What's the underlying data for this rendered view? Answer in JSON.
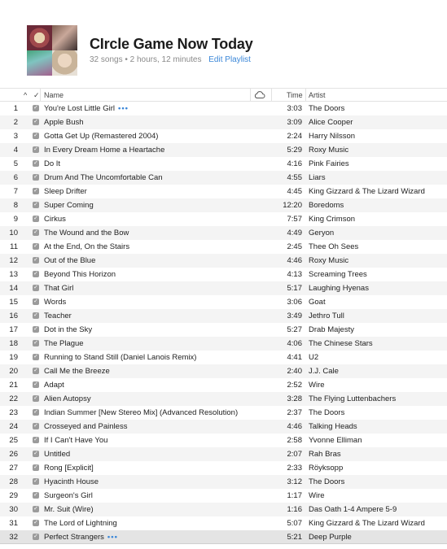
{
  "playlist": {
    "title": "CIrcle Game Now Today",
    "meta": "32 songs • 2 hours, 12 minutes",
    "edit_label": "Edit Playlist"
  },
  "columns": {
    "sort": "^",
    "check": "✓",
    "name": "Name",
    "cloud_icon": "cloud-icon",
    "time": "Time",
    "artist": "Artist"
  },
  "rows": [
    {
      "num": "1",
      "name": "You're Lost Little Girl",
      "dots": true,
      "time": "3:03",
      "artist": "The Doors"
    },
    {
      "num": "2",
      "name": "Apple Bush",
      "time": "3:09",
      "artist": "Alice Cooper"
    },
    {
      "num": "3",
      "name": "Gotta Get Up (Remastered 2004)",
      "time": "2:24",
      "artist": "Harry Nilsson"
    },
    {
      "num": "4",
      "name": "In Every Dream Home a Heartache",
      "time": "5:29",
      "artist": "Roxy Music"
    },
    {
      "num": "5",
      "name": "Do It",
      "time": "4:16",
      "artist": "Pink Fairies"
    },
    {
      "num": "6",
      "name": "Drum And The Uncomfortable Can",
      "time": "4:55",
      "artist": "Liars"
    },
    {
      "num": "7",
      "name": "Sleep Drifter",
      "time": "4:45",
      "artist": "King Gizzard & The Lizard Wizard"
    },
    {
      "num": "8",
      "name": "Super Coming",
      "time": "12:20",
      "artist": "Boredoms"
    },
    {
      "num": "9",
      "name": "Cirkus",
      "time": "7:57",
      "artist": "King Crimson"
    },
    {
      "num": "10",
      "name": "The Wound and the Bow",
      "time": "4:49",
      "artist": "Geryon"
    },
    {
      "num": "11",
      "name": "At the End, On the Stairs",
      "time": "2:45",
      "artist": "Thee Oh Sees"
    },
    {
      "num": "12",
      "name": "Out of the Blue",
      "time": "4:46",
      "artist": "Roxy Music"
    },
    {
      "num": "13",
      "name": "Beyond This Horizon",
      "time": "4:13",
      "artist": "Screaming Trees"
    },
    {
      "num": "14",
      "name": "That Girl",
      "time": "5:17",
      "artist": "Laughing Hyenas"
    },
    {
      "num": "15",
      "name": "Words",
      "time": "3:06",
      "artist": "Goat"
    },
    {
      "num": "16",
      "name": "Teacher",
      "time": "3:49",
      "artist": "Jethro Tull"
    },
    {
      "num": "17",
      "name": "Dot in the Sky",
      "time": "5:27",
      "artist": "Drab Majesty"
    },
    {
      "num": "18",
      "name": "The Plague",
      "time": "4:06",
      "artist": "The Chinese Stars"
    },
    {
      "num": "19",
      "name": "Running to Stand Still (Daniel Lanois Remix)",
      "time": "4:41",
      "artist": "U2"
    },
    {
      "num": "20",
      "name": "Call Me the Breeze",
      "time": "2:40",
      "artist": "J.J. Cale"
    },
    {
      "num": "21",
      "name": "Adapt",
      "time": "2:52",
      "artist": "Wire"
    },
    {
      "num": "22",
      "name": "Alien Autopsy",
      "time": "3:28",
      "artist": "The Flying Luttenbachers"
    },
    {
      "num": "23",
      "name": "Indian Summer [New Stereo Mix] (Advanced Resolution)",
      "time": "2:37",
      "artist": "The Doors"
    },
    {
      "num": "24",
      "name": "Crosseyed and Painless",
      "time": "4:46",
      "artist": "Talking Heads"
    },
    {
      "num": "25",
      "name": "If I Can't Have You",
      "time": "2:58",
      "artist": "Yvonne Elliman"
    },
    {
      "num": "26",
      "name": "Untitled",
      "time": "2:07",
      "artist": "Rah Bras"
    },
    {
      "num": "27",
      "name": "Rong [Explicit]",
      "time": "2:33",
      "artist": "Röyksopp"
    },
    {
      "num": "28",
      "name": "Hyacinth House",
      "time": "3:12",
      "artist": "The Doors"
    },
    {
      "num": "29",
      "name": "Surgeon's Girl",
      "time": "1:17",
      "artist": "Wire"
    },
    {
      "num": "30",
      "name": "Mr. Suit (Wire)",
      "time": "1:16",
      "artist": "Das Oath 1-4 Ampere 5-9"
    },
    {
      "num": "31",
      "name": "The Lord of Lightning",
      "time": "5:07",
      "artist": "King Gizzard & The Lizard Wizard"
    },
    {
      "num": "32",
      "name": "Perfect Strangers",
      "dots": true,
      "time": "5:21",
      "artist": "Deep Purple",
      "selected": true
    }
  ]
}
